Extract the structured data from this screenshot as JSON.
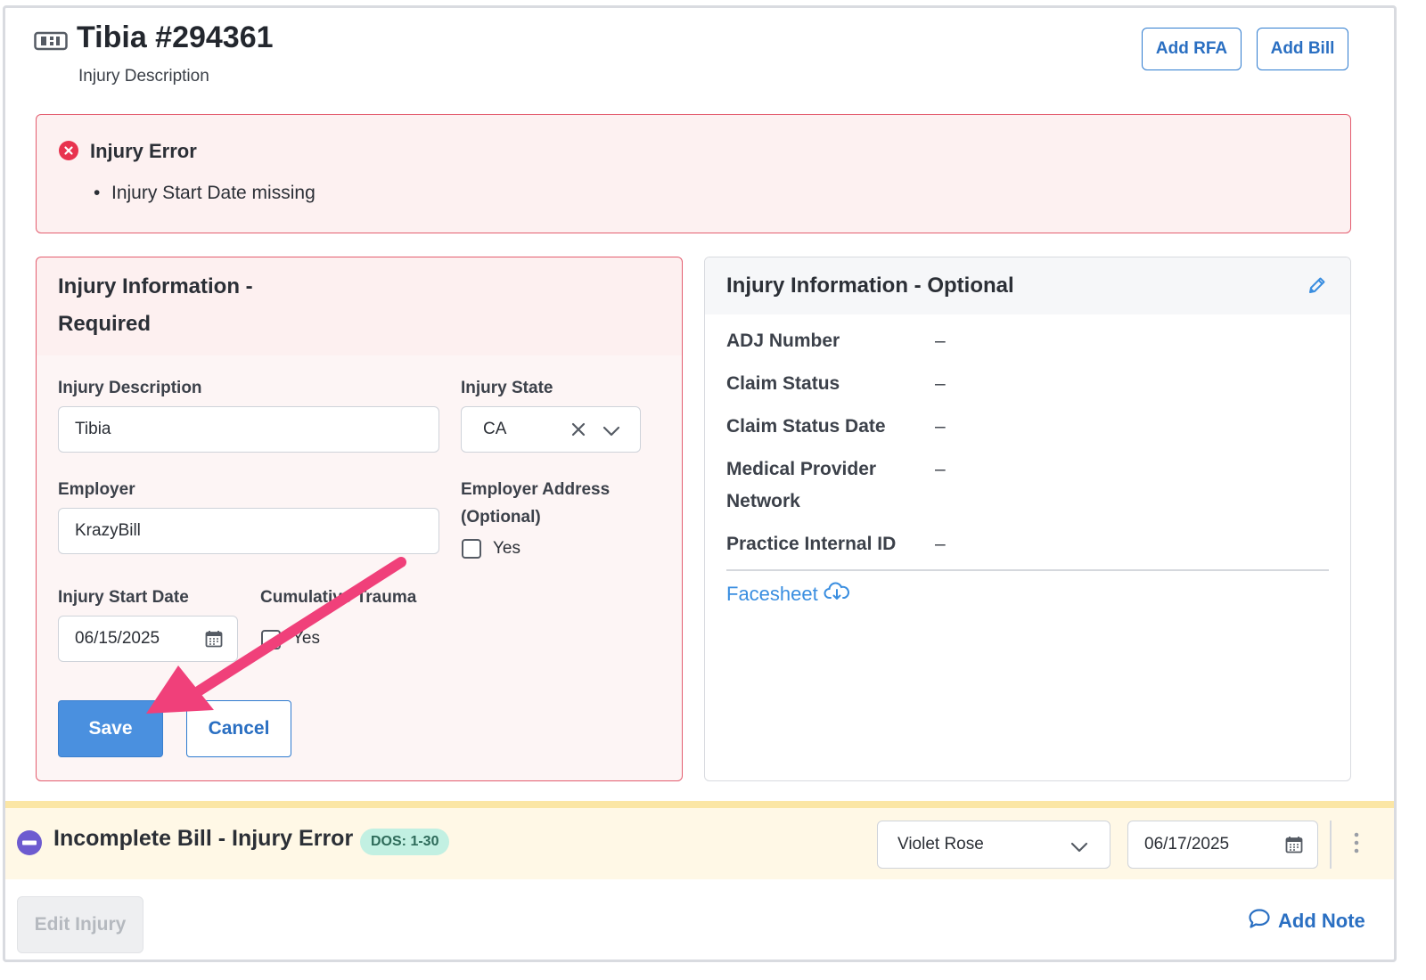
{
  "header": {
    "title": "Tibia #294361",
    "subtitle": "Injury Description",
    "add_rfa_label": "Add RFA",
    "add_bill_label": "Add Bill"
  },
  "alert": {
    "title": "Injury Error",
    "items": [
      "Injury Start Date missing"
    ]
  },
  "required_card": {
    "title_line1": "Injury Information -",
    "title_line2": "Required",
    "injury_description_label": "Injury Description",
    "injury_description_value": "Tibia",
    "injury_state_label": "Injury State",
    "injury_state_value": "CA",
    "employer_label": "Employer",
    "employer_value": "KrazyBill",
    "employer_address_label_line1": "Employer Address",
    "employer_address_label_line2": "(Optional)",
    "employer_address_checkbox_label": "Yes",
    "injury_start_date_label": "Injury Start Date",
    "injury_start_date_value": "06/15/2025",
    "cumulative_trauma_label": "Cumulative Trauma",
    "cumulative_trauma_checkbox_label": "Yes",
    "save_label": "Save",
    "cancel_label": "Cancel"
  },
  "optional_card": {
    "title": "Injury Information - Optional",
    "fields": [
      {
        "label": "ADJ Number",
        "value": "–"
      },
      {
        "label": "Claim Status",
        "value": "–"
      },
      {
        "label": "Claim Status Date",
        "value": "–"
      },
      {
        "label_line1": "Medical Provider",
        "label_line2": "Network",
        "value": "–"
      },
      {
        "label": "Practice Internal ID",
        "value": "–"
      }
    ],
    "facesheet_label": "Facesheet"
  },
  "bill": {
    "title": "Incomplete Bill - Injury Error",
    "dos_badge": "DOS: 1-30",
    "assignee": "Violet Rose",
    "date": "06/17/2025"
  },
  "footer": {
    "edit_injury_label": "Edit Injury",
    "add_note_label": "Add Note"
  },
  "colors": {
    "primary_blue": "#4a90df",
    "error_red": "#e35d6f",
    "annotation_arrow": "#f0407a",
    "bill_bar_bg": "#fff8e6",
    "dos_badge_bg": "#c2f0e2"
  }
}
